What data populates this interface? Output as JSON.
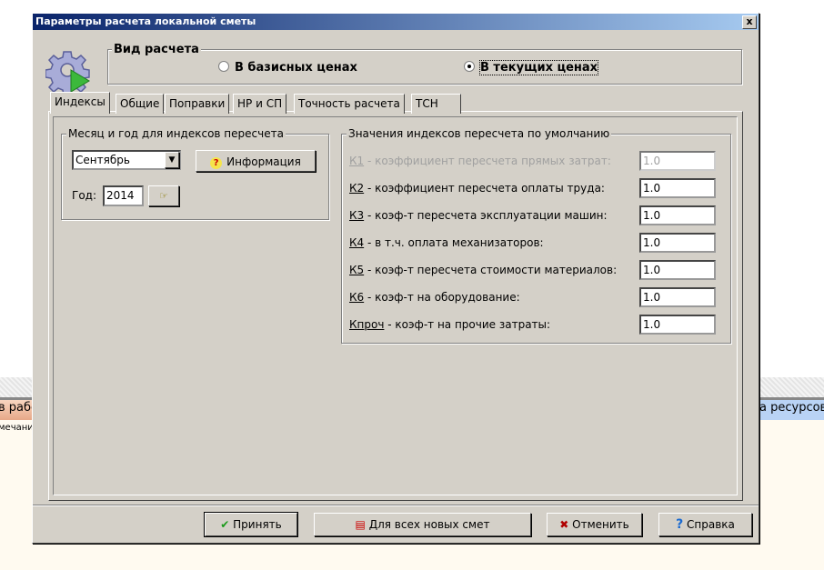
{
  "background": {
    "left_text": "в рабо",
    "left_subtext": "мечание",
    "right_text": "а ресурсов"
  },
  "dialog": {
    "title": "Параметры расчета локальной сметы",
    "close_label": "x",
    "calc_type": {
      "legend": "Вид расчета",
      "options": [
        {
          "label": "В базисных ценах",
          "selected": false
        },
        {
          "label": "В текущих ценах",
          "selected": true
        }
      ]
    },
    "tabs": [
      "Индексы",
      "Общие",
      "Поправки",
      "НР и СП",
      "Точность расчета",
      "ТСН"
    ],
    "active_tab": "Индексы",
    "month_group": {
      "legend": "Месяц и год для индексов пересчета",
      "month": "Сентябрь",
      "info_button": "Информация",
      "year_label": "Год:",
      "year": "2014"
    },
    "index_group": {
      "legend": "Значения индексов пересчета по умолчанию",
      "rows": [
        {
          "key": "К1",
          "label": " - коэффициент пересчета прямых затрат:",
          "value": "1.0",
          "disabled": true
        },
        {
          "key": "К2",
          "label": " - коэффициент пересчета оплаты труда:",
          "value": "1.0",
          "disabled": false
        },
        {
          "key": "К3",
          "label": " - коэф-т пересчета эксплуатации машин:",
          "value": "1.0",
          "disabled": false
        },
        {
          "key": "К4",
          "label": " - в т.ч. оплата механизаторов:",
          "value": "1.0",
          "disabled": false
        },
        {
          "key": "К5",
          "label": " - коэф-т пересчета стоимости материалов:",
          "value": "1.0",
          "disabled": false
        },
        {
          "key": "К6",
          "label": " - коэф-т на оборудование:",
          "value": "1.0",
          "disabled": false
        },
        {
          "key": "Кпроч",
          "label": " - коэф-т на прочие затраты:",
          "value": "1.0",
          "disabled": false
        }
      ]
    },
    "buttons": {
      "accept": "Принять",
      "for_all": "Для всех новых смет",
      "cancel": "Отменить",
      "help": "Справка"
    }
  }
}
